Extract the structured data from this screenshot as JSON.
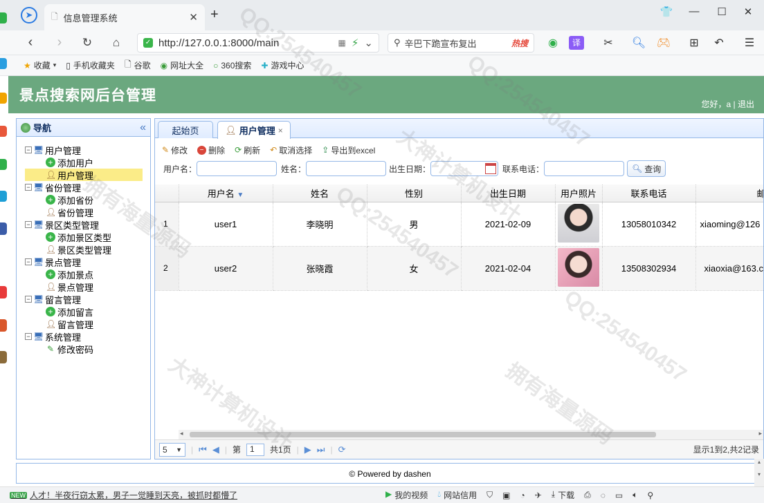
{
  "browser": {
    "tab_title": "信息管理系统",
    "url": "http://127.0.0.1:8000/main",
    "search_text": "辛巴下跪宣布复出",
    "search_hot": "热搜",
    "bookmarks": [
      "收藏",
      "手机收藏夹",
      "谷歌",
      "网址大全",
      "360搜索",
      "游戏中心"
    ]
  },
  "app": {
    "title": "景点搜索网后台管理",
    "user_greeting": "您好，a",
    "logout": "退出"
  },
  "nav": {
    "title": "导航",
    "groups": [
      {
        "label": "用户管理",
        "items": [
          "添加用户",
          "用户管理"
        ]
      },
      {
        "label": "省份管理",
        "items": [
          "添加省份",
          "省份管理"
        ]
      },
      {
        "label": "景区类型管理",
        "items": [
          "添加景区类型",
          "景区类型管理"
        ]
      },
      {
        "label": "景点管理",
        "items": [
          "添加景点",
          "景点管理"
        ]
      },
      {
        "label": "留言管理",
        "items": [
          "添加留言",
          "留言管理"
        ]
      },
      {
        "label": "系统管理",
        "items": [
          "修改密码"
        ]
      }
    ]
  },
  "tabs": [
    {
      "label": "起始页"
    },
    {
      "label": "用户管理",
      "close": "×"
    }
  ],
  "toolbar": {
    "edit": "修改",
    "delete": "删除",
    "refresh": "刷新",
    "cancel_select": "取消选择",
    "export": "导出到excel"
  },
  "filters": {
    "username_label": "用户名：",
    "name_label": "姓名：",
    "birth_label": "出生日期：",
    "phone_label": "联系电话：",
    "query": "查询"
  },
  "grid": {
    "columns": [
      "用户名",
      "姓名",
      "性别",
      "出生日期",
      "用户照片",
      "联系电话",
      "邮箱"
    ],
    "rows": [
      {
        "rownum": "1",
        "username": "user1",
        "name": "李晓明",
        "gender": "男",
        "birth": "2021-02-09",
        "phone": "13058010342",
        "email": "xiaoming@126"
      },
      {
        "rownum": "2",
        "username": "user2",
        "name": "张晓霞",
        "gender": "女",
        "birth": "2021-02-04",
        "phone": "13508302934",
        "email": "xiaoxia@163.c"
      }
    ]
  },
  "pager": {
    "page_size": "5",
    "page_prefix": "第",
    "page": "1",
    "page_total": "共1页",
    "summary": "显示1到2,共2记录"
  },
  "footer": "© Powered by dashen",
  "statusbar": {
    "news_badge": "NEW",
    "news": "人才！半夜行窃太累，男子一觉睡到天亮，被抓时都懵了",
    "video": "我的视频",
    "credit": "网站信用",
    "download": "下载"
  },
  "watermarks": [
    "QQ:254540457",
    "大神计算机设计",
    "拥有海量源码"
  ]
}
